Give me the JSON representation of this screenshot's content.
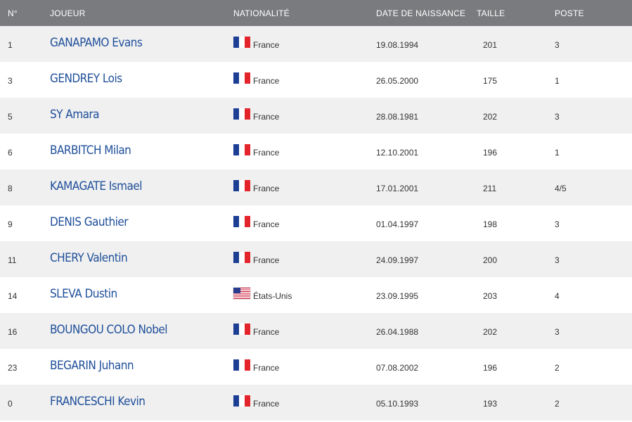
{
  "header": {
    "num": "N°",
    "player": "JOUEUR",
    "nationality": "NATIONALITÉ",
    "birthdate": "DATE DE NAISSANCE",
    "height": "TAILLE",
    "position": "POSTE"
  },
  "colors": {
    "header_bg": "#7a7b7e",
    "row_alt_bg": "#f0f0f0",
    "player_link": "#1f4f9a"
  },
  "players": [
    {
      "num": "1",
      "name": "GANAPAMO Evans",
      "flag": "fr-flag-icon",
      "nationality": "France",
      "birthdate": "19.08.1994",
      "height": "201",
      "position": "3"
    },
    {
      "num": "3",
      "name": "GENDREY Lois",
      "flag": "fr-flag-icon",
      "nationality": "France",
      "birthdate": "26.05.2000",
      "height": "175",
      "position": "1"
    },
    {
      "num": "5",
      "name": "SY Amara",
      "flag": "fr-flag-icon",
      "nationality": "France",
      "birthdate": "28.08.1981",
      "height": "202",
      "position": "3"
    },
    {
      "num": "6",
      "name": "BARBITCH Milan",
      "flag": "fr-flag-icon",
      "nationality": "France",
      "birthdate": "12.10.2001",
      "height": "196",
      "position": "1"
    },
    {
      "num": "8",
      "name": "KAMAGATE Ismael",
      "flag": "fr-flag-icon",
      "nationality": "France",
      "birthdate": "17.01.2001",
      "height": "211",
      "position": "4/5"
    },
    {
      "num": "9",
      "name": "DENIS Gauthier",
      "flag": "fr-flag-icon",
      "nationality": "France",
      "birthdate": "01.04.1997",
      "height": "198",
      "position": "3"
    },
    {
      "num": "11",
      "name": "CHERY Valentin",
      "flag": "fr-flag-icon",
      "nationality": "France",
      "birthdate": "24.09.1997",
      "height": "200",
      "position": "3"
    },
    {
      "num": "14",
      "name": "SLEVA Dustin",
      "flag": "us-flag-icon",
      "nationality": "États-Unis",
      "birthdate": "23.09.1995",
      "height": "203",
      "position": "4"
    },
    {
      "num": "16",
      "name": "BOUNGOU COLO Nobel",
      "flag": "fr-flag-icon",
      "nationality": "France",
      "birthdate": "26.04.1988",
      "height": "202",
      "position": "3"
    },
    {
      "num": "23",
      "name": "BEGARIN Juhann",
      "flag": "fr-flag-icon",
      "nationality": "France",
      "birthdate": "07.08.2002",
      "height": "196",
      "position": "2"
    },
    {
      "num": "0",
      "name": "FRANCESCHI Kevin",
      "flag": "fr-flag-icon",
      "nationality": "France",
      "birthdate": "05.10.1993",
      "height": "193",
      "position": "2"
    }
  ]
}
